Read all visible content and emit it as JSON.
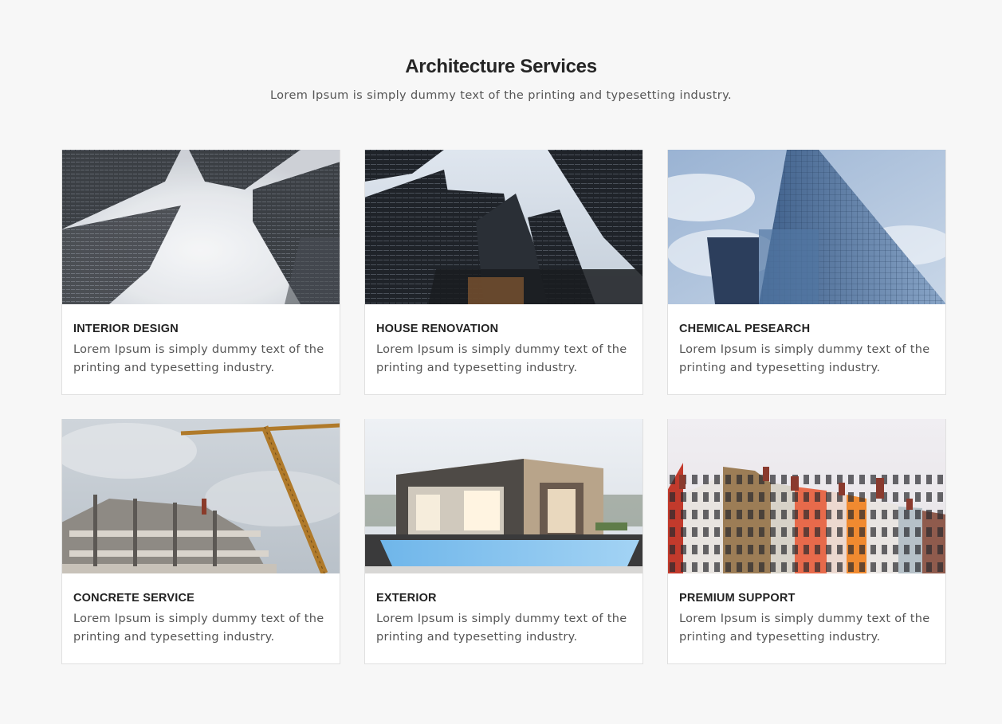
{
  "header": {
    "title": "Architecture Services",
    "subtitle": "Lorem Ipsum is simply dummy text of the printing and typesetting industry."
  },
  "cards": [
    {
      "title": "INTERIOR DESIGN",
      "text": "Lorem Ipsum is simply dummy text of the printing and typesetting industry.",
      "image": "skyscrapers-in-fog-photo"
    },
    {
      "title": "HOUSE RENOVATION",
      "text": "Lorem Ipsum is simply dummy text of the printing and typesetting industry.",
      "image": "glass-towers-upward-photo"
    },
    {
      "title": "CHEMICAL PESEARCH",
      "text": "Lorem Ipsum is simply dummy text of the printing and typesetting industry.",
      "image": "blue-glass-skyscraper-photo"
    },
    {
      "title": "CONCRETE SERVICE",
      "text": "Lorem Ipsum is simply dummy text of the printing and typesetting industry.",
      "image": "construction-crane-photo"
    },
    {
      "title": "EXTERIOR",
      "text": "Lorem Ipsum is simply dummy text of the printing and typesetting industry.",
      "image": "modern-house-pool-photo"
    },
    {
      "title": "PREMIUM SUPPORT",
      "text": "Lorem Ipsum is simply dummy text of the printing and typesetting industry.",
      "image": "colorful-townhouses-photo"
    }
  ],
  "colors": {
    "background": "#f7f7f7",
    "card": "#ffffff",
    "title": "#252525",
    "body_text": "#555555"
  }
}
